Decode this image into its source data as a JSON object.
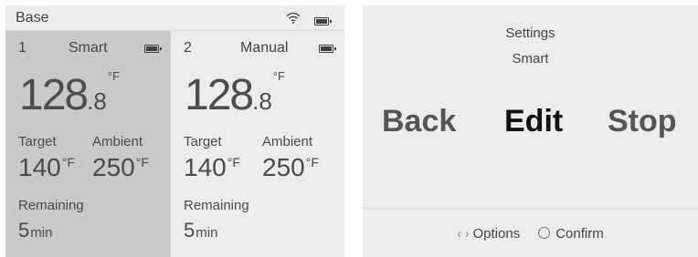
{
  "base": {
    "title": "Base",
    "icons": {
      "wifi": "wifi-icon",
      "battery": "battery-icon"
    }
  },
  "probes": [
    {
      "number": "1",
      "mode": "Smart",
      "temp_whole": "128",
      "temp_decimal": ".8",
      "temp_unit": "°F",
      "target_label": "Target",
      "ambient_label": "Ambient",
      "target_value": "140",
      "target_unit": "°F",
      "ambient_value": "250",
      "ambient_unit": "°F",
      "remaining_label": "Remaining",
      "remaining_value": "5",
      "remaining_unit": "min",
      "selected": true
    },
    {
      "number": "2",
      "mode": "Manual",
      "temp_whole": "128",
      "temp_decimal": ".8",
      "temp_unit": "°F",
      "target_label": "Target",
      "ambient_label": "Ambient",
      "target_value": "140",
      "target_unit": "°F",
      "ambient_value": "250",
      "ambient_unit": "°F",
      "remaining_label": "Remaining",
      "remaining_value": "5",
      "remaining_unit": "min",
      "selected": false
    }
  ],
  "settings": {
    "title": "Settings",
    "subtitle": "Smart",
    "options": [
      "Back",
      "Edit",
      "Stop"
    ],
    "selected_option": "Edit",
    "footer_nav_glyph": "‹ ›",
    "footer_options_label": "Options",
    "footer_confirm_label": "Confirm"
  },
  "colors": {
    "selected_panel_bg": "#c9c9c9",
    "panel_bg": "#ececec",
    "selected_option_text": "#111111",
    "option_text": "#555555"
  }
}
